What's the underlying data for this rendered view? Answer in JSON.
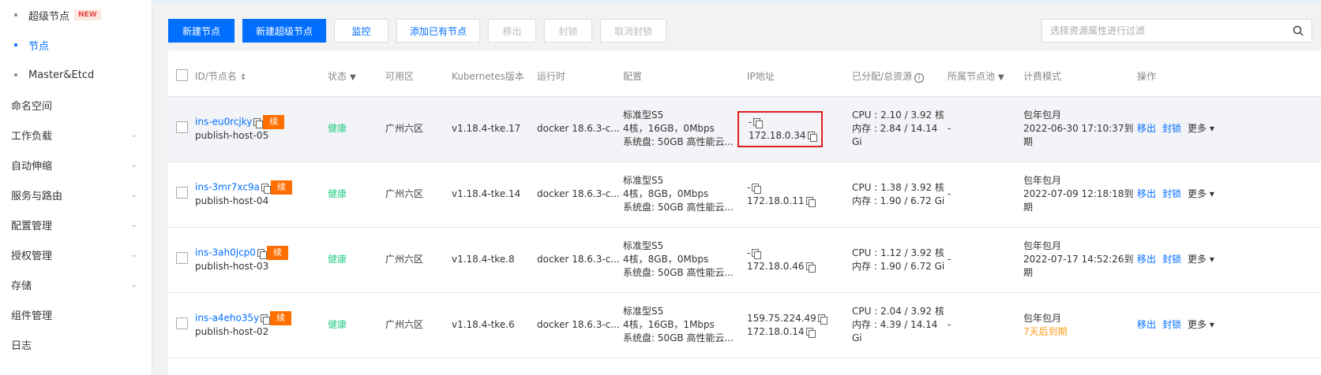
{
  "sidebar": {
    "subitems": [
      {
        "label": "超级节点",
        "badge": "NEW"
      },
      {
        "label": "节点"
      },
      {
        "label": "Master&Etcd"
      }
    ],
    "items": [
      {
        "label": "命名空间",
        "has_chevron": false
      },
      {
        "label": "工作负载",
        "has_chevron": true
      },
      {
        "label": "自动伸缩",
        "has_chevron": true
      },
      {
        "label": "服务与路由",
        "has_chevron": true
      },
      {
        "label": "配置管理",
        "has_chevron": true
      },
      {
        "label": "授权管理",
        "has_chevron": true
      },
      {
        "label": "存储",
        "has_chevron": true
      },
      {
        "label": "组件管理",
        "has_chevron": false
      },
      {
        "label": "日志",
        "has_chevron": false
      }
    ]
  },
  "toolbar": {
    "new_node": "新建节点",
    "new_super_node": "新建超级节点",
    "monitor": "监控",
    "add_existing": "添加已有节点",
    "remove": "移出",
    "cordon": "封锁",
    "uncordon": "取消封锁"
  },
  "search": {
    "placeholder": "选择资源属性进行过滤"
  },
  "table": {
    "headers": {
      "id": "ID/节点名",
      "status": "状态",
      "zone": "可用区",
      "k8s": "Kubernetes版本",
      "runtime": "运行时",
      "config": "配置",
      "ip": "IP地址",
      "alloc": "已分配/总资源",
      "pool": "所属节点池",
      "billing": "计费模式",
      "ops": "操作"
    },
    "renew_label": "续",
    "op_remove": "移出",
    "op_cordon": "封锁",
    "op_more": "更多",
    "rows": [
      {
        "id": "ins-eu0rcjky",
        "name": "publish-host-05",
        "status": "健康",
        "zone": "广州六区",
        "k8s": "v1.18.4-tke.17",
        "runtime": "docker 18.6.3-c...",
        "config1": "标准型S5",
        "config2": "4核，16GB，0Mbps",
        "config3": "系统盘: 50GB 高性能云...",
        "ip1": "-",
        "ip2": "172.18.0.34",
        "cpu": "CPU : 2.10 / 3.92 核",
        "mem": "内存 : 2.84 / 14.14",
        "mem2": "Gi",
        "pool": "-",
        "billing": "包年包月",
        "expire": "2022-06-30 17:10:37到期"
      },
      {
        "id": "ins-3mr7xc9a",
        "name": "publish-host-04",
        "status": "健康",
        "zone": "广州六区",
        "k8s": "v1.18.4-tke.14",
        "runtime": "docker 18.6.3-c...",
        "config1": "标准型S5",
        "config2": "4核，8GB，0Mbps",
        "config3": "系统盘: 50GB 高性能云...",
        "ip1": "-",
        "ip2": "172.18.0.11",
        "cpu": "CPU : 1.38 / 3.92 核",
        "mem": "内存 : 1.90 / 6.72 Gi",
        "mem2": "",
        "pool": "-",
        "billing": "包年包月",
        "expire": "2022-07-09 12:18:18到期"
      },
      {
        "id": "ins-3ah0jcp0",
        "name": "publish-host-03",
        "status": "健康",
        "zone": "广州六区",
        "k8s": "v1.18.4-tke.8",
        "runtime": "docker 18.6.3-c...",
        "config1": "标准型S5",
        "config2": "4核，8GB，0Mbps",
        "config3": "系统盘: 50GB 高性能云...",
        "ip1": "-",
        "ip2": "172.18.0.46",
        "cpu": "CPU : 1.12 / 3.92 核",
        "mem": "内存 : 1.90 / 6.72 Gi",
        "mem2": "",
        "pool": "-",
        "billing": "包年包月",
        "expire": "2022-07-17 14:52:26到期"
      },
      {
        "id": "ins-a4eho35y",
        "name": "publish-host-02",
        "status": "健康",
        "zone": "广州六区",
        "k8s": "v1.18.4-tke.6",
        "runtime": "docker 18.6.3-c...",
        "config1": "标准型S5",
        "config2": "4核，16GB，1Mbps",
        "config3": "系统盘: 50GB 高性能云...",
        "ip1": "159.75.224.49",
        "ip2": "172.18.0.14",
        "cpu": "CPU : 2.04 / 3.92 核",
        "mem": "内存 : 4.39 / 14.14",
        "mem2": "Gi",
        "pool": "-",
        "billing": "包年包月",
        "expire": "7天后到期"
      }
    ]
  },
  "colors": {
    "primary": "#006eff",
    "healthy": "#29cc85",
    "warning": "#ff9c19",
    "renew": "#ff6f00",
    "highlight_box": "#e02020"
  }
}
